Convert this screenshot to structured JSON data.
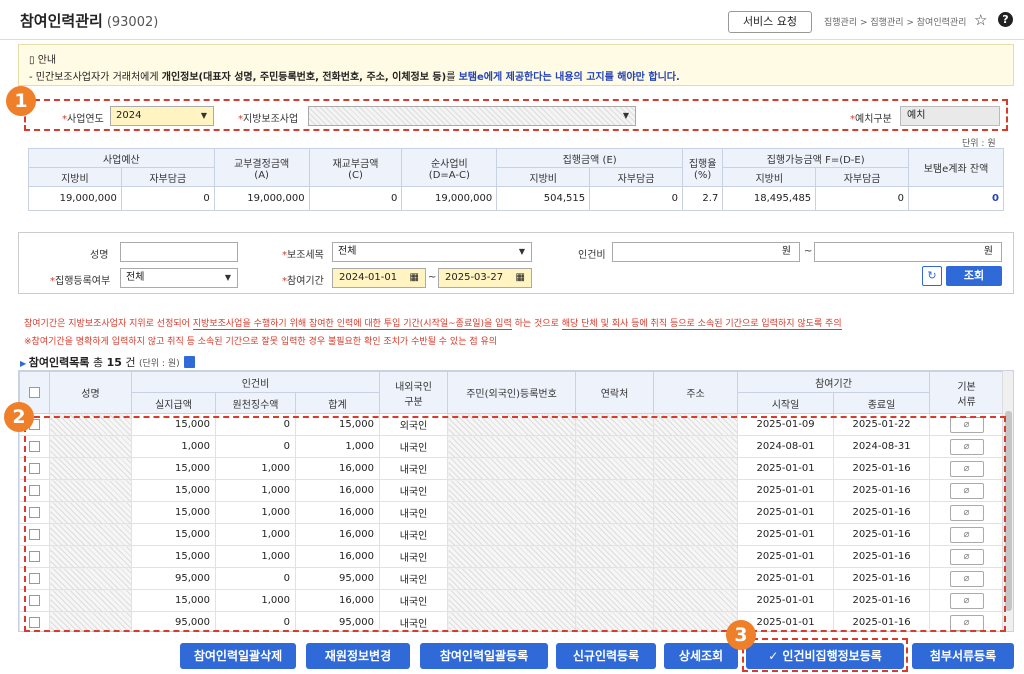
{
  "header": {
    "title": "참여인력관리",
    "code": "(93002)",
    "service_button": "서비스 요청",
    "breadcrumb": "집행관리 > 집행관리 > 참여인력관리",
    "star_icon": "☆",
    "help_icon": "?"
  },
  "notice": {
    "heading": "안내",
    "line_prefix": "- 민간보조사업자가 거래처에게 ",
    "line_bold": "개인정보(대표자 성명, 주민등록번호, 전화번호, 주소, 이체정보 등)",
    "line_mid": "를 ",
    "line_blue": "보탬e에게 제공한다는 내용의 고지를 해야만 합니다."
  },
  "markers": [
    "1",
    "2",
    "3"
  ],
  "filter1": {
    "year_label": "사업연도",
    "year_value": "2024",
    "project_label": "지방보조사업",
    "deposit_label": "예치구분",
    "deposit_value": "예치"
  },
  "budget": {
    "unit": "단위 : 원",
    "h": {
      "budget": "사업예산",
      "local": "지방비",
      "self": "자부담금",
      "grant": "교부결정금액",
      "grant_sub": "(A)",
      "refund": "재교부금액",
      "refund_sub": "(C)",
      "net": "순사업비",
      "net_sub": "(D=A-C)",
      "exec": "집행금액 (E)",
      "exec_local": "지방비",
      "exec_self": "자부담금",
      "rate": "집행율",
      "rate_sub": "(%)",
      "avail": "집행가능금액 F=(D-E)",
      "avail_local": "지방비",
      "avail_self": "자부담금",
      "balance": "보탬e계좌 잔액"
    },
    "values": {
      "local": "19,000,000",
      "self": "0",
      "grant": "19,000,000",
      "refund": "0",
      "net": "19,000,000",
      "exec_local": "504,515",
      "exec_self": "0",
      "rate": "2.7",
      "avail_local": "18,495,485",
      "avail_self": "0",
      "balance": "0"
    }
  },
  "search": {
    "name_label": "성명",
    "subitem_label": "보조세목",
    "subitem_value": "전체",
    "labor_label": "인건비",
    "won": "원",
    "tilde": "~",
    "regflag_label": "집행등록여부",
    "regflag_value": "전체",
    "period_label": "참여기간",
    "period_from": "2024-01-01",
    "period_to": "2025-03-27",
    "search_button": "조회"
  },
  "warnings": {
    "w1_a": "참여기간은 지방보조사업자 지위로 선정되어 ",
    "w1_b": "지방보조사업을 수행하기 위해 참여한 인력에 대한 투입 기간(시작일~종료일)을 입력",
    "w1_c": " 하는 것으로 ",
    "w1_d": "해당 단체 및 회사 등에 취직 등으로 소속된 기간으로 입력하지 않도록 주의",
    "w2": "※참여기간을 명확하게 입력하지 않고 취직 등 소속된 기간으로 잘못 입력한 경우 불필요한 확인 조치가 수반될 수 있는 점 유의"
  },
  "list": {
    "title": "참여인력목록",
    "count_prefix": "총",
    "count": "15",
    "count_suffix": "건",
    "unit": "(단위 : 원)",
    "h": {
      "name": "성명",
      "labor": "인건비",
      "actual": "실지급액",
      "withhold": "원천징수액",
      "total": "합계",
      "nationality": "내외국인",
      "nationality2": "구분",
      "regno": "주민(외국인)등록번호",
      "contact": "연락처",
      "address": "주소",
      "period": "참여기간",
      "start": "시작일",
      "end": "종료일",
      "docs": "기본",
      "docs2": "서류"
    },
    "rows": [
      {
        "actual": "15,000",
        "withhold": "0",
        "total": "15,000",
        "nat": "외국인",
        "start": "2025-01-09",
        "end": "2025-01-22"
      },
      {
        "actual": "1,000",
        "withhold": "0",
        "total": "1,000",
        "nat": "내국인",
        "start": "2024-08-01",
        "end": "2024-08-31"
      },
      {
        "actual": "15,000",
        "withhold": "1,000",
        "total": "16,000",
        "nat": "내국인",
        "start": "2025-01-01",
        "end": "2025-01-16"
      },
      {
        "actual": "15,000",
        "withhold": "1,000",
        "total": "16,000",
        "nat": "내국인",
        "start": "2025-01-01",
        "end": "2025-01-16"
      },
      {
        "actual": "15,000",
        "withhold": "1,000",
        "total": "16,000",
        "nat": "내국인",
        "start": "2025-01-01",
        "end": "2025-01-16"
      },
      {
        "actual": "15,000",
        "withhold": "1,000",
        "total": "16,000",
        "nat": "내국인",
        "start": "2025-01-01",
        "end": "2025-01-16"
      },
      {
        "actual": "15,000",
        "withhold": "1,000",
        "total": "16,000",
        "nat": "내국인",
        "start": "2025-01-01",
        "end": "2025-01-16"
      },
      {
        "actual": "95,000",
        "withhold": "0",
        "total": "95,000",
        "nat": "내국인",
        "start": "2025-01-01",
        "end": "2025-01-16"
      },
      {
        "actual": "15,000",
        "withhold": "1,000",
        "total": "16,000",
        "nat": "내국인",
        "start": "2025-01-01",
        "end": "2025-01-16"
      },
      {
        "actual": "95,000",
        "withhold": "0",
        "total": "95,000",
        "nat": "내국인",
        "start": "2025-01-01",
        "end": "2025-01-16"
      }
    ]
  },
  "buttons": {
    "bulk_delete": "참여인력일괄삭제",
    "fund_change": "재원정보변경",
    "bulk_register": "참여인력일괄등록",
    "new_register": "신규인력등록",
    "detail": "상세조회",
    "labor_exec": "✓ 인건비집행정보등록",
    "attach": "첨부서류등록"
  }
}
